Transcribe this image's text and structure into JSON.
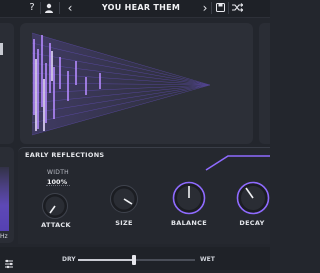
{
  "topbar": {
    "help_icon": "?",
    "user_icon": "user-icon",
    "prev_icon": "‹",
    "preset_name": "YOU HEAR THEM",
    "next_icon": "›",
    "save_icon": "save-icon",
    "random_icon": "shuffle-icon"
  },
  "early_reflections": {
    "title": "EARLY REFLECTIONS",
    "width_label": "WIDTH",
    "width_value": "100%",
    "knobs": [
      {
        "label": "ATTACK"
      },
      {
        "label": "SIZE"
      },
      {
        "label": "BALANCE"
      },
      {
        "label": "DECAY"
      }
    ]
  },
  "left_panel": {
    "freq_unit": "Hz"
  },
  "mix": {
    "dry_label": "DRY",
    "wet_label": "WET",
    "value": 0.48
  },
  "colors": {
    "accent": "#8f6bff",
    "reflection_line": "#b58aff",
    "panel": "#2c2f37"
  }
}
